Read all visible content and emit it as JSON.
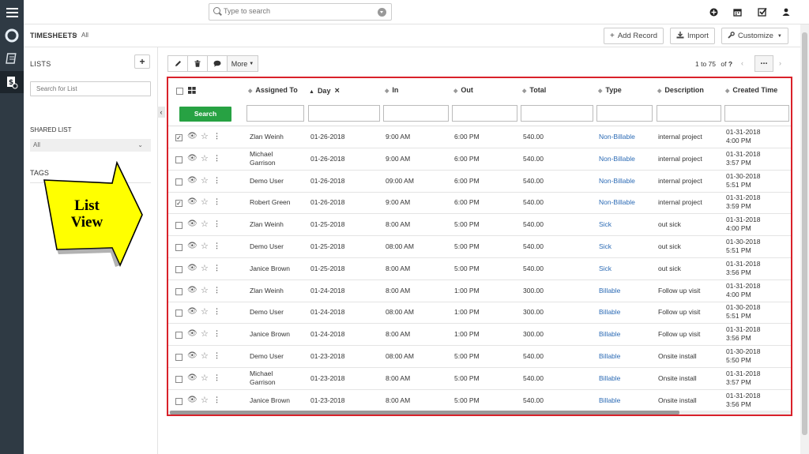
{
  "topbar": {
    "search_placeholder": "Type to search",
    "icons": [
      "plus-circle-icon",
      "calendar-icon",
      "checkbox-icon",
      "user-icon"
    ]
  },
  "rail": {
    "icons": [
      "menu-icon",
      "lifebuoy-icon",
      "timesheet-icon",
      "dollar-list-icon"
    ]
  },
  "breadcrumb": {
    "module": "TIMESHEETS",
    "separator": ">",
    "current": "All"
  },
  "header_buttons": {
    "add_record": "Add Record",
    "import": "Import",
    "customize": "Customize"
  },
  "sidebar": {
    "lists_title": "LISTS",
    "add_label": "+",
    "search_placeholder": "Search for List",
    "shared_list_title": "SHARED LIST",
    "shared_list_value": "All",
    "tags_title": "TAGS"
  },
  "callout": {
    "line1": "List",
    "line2": "View",
    "fill_color": "#ffff00"
  },
  "toolbar": {
    "more_label": "More"
  },
  "pagination": {
    "range": "1 to 75",
    "of_label": "of",
    "total": "?",
    "dots": "..."
  },
  "table": {
    "columns": [
      "Assigned To",
      "Day",
      "In",
      "Out",
      "Total",
      "Type",
      "Description",
      "Created Time"
    ],
    "search_button": "Search",
    "clear_sort": "×",
    "rows": [
      {
        "checked": true,
        "assigned": [
          "Zlan Weinh"
        ],
        "day": "01-26-2018",
        "in": "9:00 AM",
        "out": "6:00 PM",
        "total": "540.00",
        "type": "Non-Billable",
        "desc": "internal project",
        "created": [
          "01-31-2018",
          "4:00 PM"
        ]
      },
      {
        "checked": false,
        "assigned": [
          "Michael",
          "Garrison"
        ],
        "day": "01-26-2018",
        "in": "9:00 AM",
        "out": "6:00 PM",
        "total": "540.00",
        "type": "Non-Billable",
        "desc": "internal project",
        "created": [
          "01-31-2018",
          "3:57 PM"
        ]
      },
      {
        "checked": false,
        "assigned": [
          "Demo User"
        ],
        "day": "01-26-2018",
        "in": "09:00 AM",
        "out": "6:00 PM",
        "total": "540.00",
        "type": "Non-Billable",
        "desc": "internal project",
        "created": [
          "01-30-2018",
          "5:51 PM"
        ]
      },
      {
        "checked": true,
        "assigned": [
          "Robert Green"
        ],
        "day": "01-26-2018",
        "in": "9:00 AM",
        "out": "6:00 PM",
        "total": "540.00",
        "type": "Non-Billable",
        "desc": "internal project",
        "created": [
          "01-31-2018",
          "3:59 PM"
        ]
      },
      {
        "checked": false,
        "assigned": [
          "Zlan Weinh"
        ],
        "day": "01-25-2018",
        "in": "8:00 AM",
        "out": "5:00 PM",
        "total": "540.00",
        "type": "Sick",
        "desc": "out sick",
        "created": [
          "01-31-2018",
          "4:00 PM"
        ]
      },
      {
        "checked": false,
        "assigned": [
          "Demo User"
        ],
        "day": "01-25-2018",
        "in": "08:00 AM",
        "out": "5:00 PM",
        "total": "540.00",
        "type": "Sick",
        "desc": "out sick",
        "created": [
          "01-30-2018",
          "5:51 PM"
        ]
      },
      {
        "checked": false,
        "assigned": [
          "Janice Brown"
        ],
        "day": "01-25-2018",
        "in": "8:00 AM",
        "out": "5:00 PM",
        "total": "540.00",
        "type": "Sick",
        "desc": "out sick",
        "created": [
          "01-31-2018",
          "3:56 PM"
        ]
      },
      {
        "checked": false,
        "assigned": [
          "Zlan Weinh"
        ],
        "day": "01-24-2018",
        "in": "8:00 AM",
        "out": "1:00 PM",
        "total": "300.00",
        "type": "Billable",
        "desc": "Follow up visit",
        "created": [
          "01-31-2018",
          "4:00 PM"
        ]
      },
      {
        "checked": false,
        "assigned": [
          "Demo User"
        ],
        "day": "01-24-2018",
        "in": "08:00 AM",
        "out": "1:00 PM",
        "total": "300.00",
        "type": "Billable",
        "desc": "Follow up visit",
        "created": [
          "01-30-2018",
          "5:51 PM"
        ]
      },
      {
        "checked": false,
        "assigned": [
          "Janice Brown"
        ],
        "day": "01-24-2018",
        "in": "8:00 AM",
        "out": "1:00 PM",
        "total": "300.00",
        "type": "Billable",
        "desc": "Follow up visit",
        "created": [
          "01-31-2018",
          "3:56 PM"
        ]
      },
      {
        "checked": false,
        "assigned": [
          "Demo User"
        ],
        "day": "01-23-2018",
        "in": "08:00 AM",
        "out": "5:00 PM",
        "total": "540.00",
        "type": "Billable",
        "desc": "Onsite install",
        "created": [
          "01-30-2018",
          "5:50 PM"
        ]
      },
      {
        "checked": false,
        "assigned": [
          "Michael",
          "Garrison"
        ],
        "day": "01-23-2018",
        "in": "8:00 AM",
        "out": "5:00 PM",
        "total": "540.00",
        "type": "Billable",
        "desc": "Onsite install",
        "created": [
          "01-31-2018",
          "3:57 PM"
        ]
      },
      {
        "checked": false,
        "assigned": [
          "Janice Brown"
        ],
        "day": "01-23-2018",
        "in": "8:00 AM",
        "out": "5:00 PM",
        "total": "540.00",
        "type": "Billable",
        "desc": "Onsite install",
        "created": [
          "01-31-2018",
          "3:56 PM"
        ]
      }
    ]
  },
  "colors": {
    "rail": "#2f3a44",
    "highlight_border": "#d9212a",
    "search_button": "#27a243",
    "link": "#2c6bb5"
  }
}
